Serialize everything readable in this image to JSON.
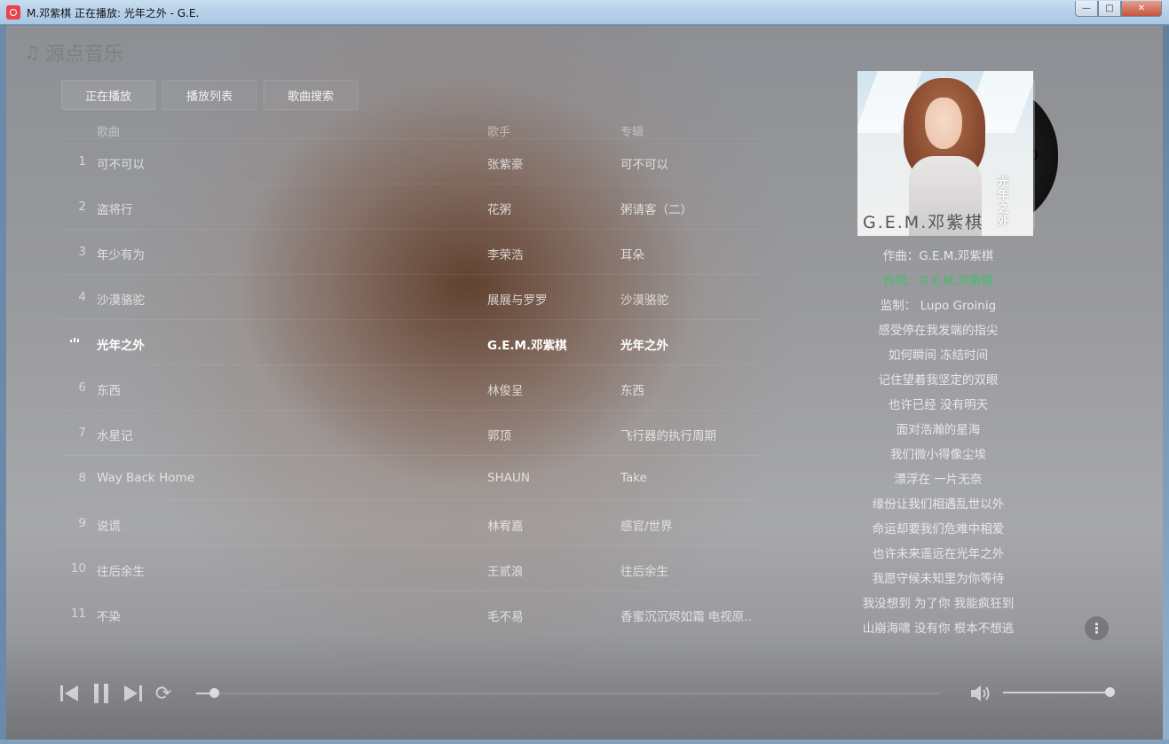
{
  "window": {
    "title": "M.邓紫棋 正在播放: 光年之外 - G.E.",
    "min_glyph": "—",
    "max_glyph": "□",
    "close_glyph": "✕"
  },
  "app": {
    "note_glyph": "♫",
    "name": "源点音乐"
  },
  "tabs": [
    {
      "label": "正在播放",
      "active": true
    },
    {
      "label": "播放列表",
      "active": false
    },
    {
      "label": "歌曲搜索",
      "active": false
    }
  ],
  "list": {
    "columns": {
      "title": "歌曲",
      "artist": "歌手",
      "album": "专辑"
    },
    "rows": [
      {
        "index": "1",
        "title": "可不可以",
        "artist": "张紫豪",
        "album": "可不可以"
      },
      {
        "index": "2",
        "title": "盗将行",
        "artist": "花粥",
        "album": "粥请客（二）"
      },
      {
        "index": "3",
        "title": "年少有为",
        "artist": "李荣浩",
        "album": "耳朵"
      },
      {
        "index": "4",
        "title": "沙漠骆驼",
        "artist": "展展与罗罗",
        "album": "沙漠骆驼"
      },
      {
        "index": "",
        "title": "光年之外",
        "artist": "G.E.M.邓紫棋",
        "album": "光年之外",
        "playing": true
      },
      {
        "index": "6",
        "title": "东西",
        "artist": "林俊呈",
        "album": "东西"
      },
      {
        "index": "7",
        "title": "水星记",
        "artist": "郭顶",
        "album": "飞行器的执行周期"
      },
      {
        "index": "8",
        "title": "Way Back Home",
        "artist": "SHAUN",
        "album": "Take"
      },
      {
        "index": "9",
        "title": "说谎",
        "artist": "林宥嘉",
        "album": "感官/世界"
      },
      {
        "index": "10",
        "title": "往后余生",
        "artist": "王贰浪",
        "album": "往后余生"
      },
      {
        "index": "11",
        "title": "不染",
        "artist": "毛不易",
        "album": "香蜜沉沉烬如霜 电视原.."
      }
    ]
  },
  "album": {
    "cover_vertical_text": "光年之外",
    "cover_brand": "G.E.M.邓紫棋"
  },
  "lyrics": {
    "lines": [
      "作曲：G.E.M.邓紫棋",
      "作词：G.E.M.邓紫棋",
      "监制： Lupo Groinig",
      "感受停在我发端的指尖",
      "如何瞬间 冻结时间",
      "记住望着我坚定的双眼",
      "也许已经 没有明天",
      "面对浩瀚的星海",
      "我们微小得像尘埃",
      "漂浮在 一片无奈",
      "缘份让我们相遇乱世以外",
      "命运却要我们危难中相爱",
      "也许未来遥远在光年之外",
      "我愿守候未知里为你等待",
      "我没想到 为了你 我能疯狂到",
      "山崩海啸 没有你 根本不想逃"
    ],
    "current_index": 1,
    "current_color": "#3fbf6a"
  },
  "more_glyph": "⋮",
  "player": {
    "progress": 0.02,
    "volume": 1.0,
    "repeat_glyph": "⟳"
  }
}
